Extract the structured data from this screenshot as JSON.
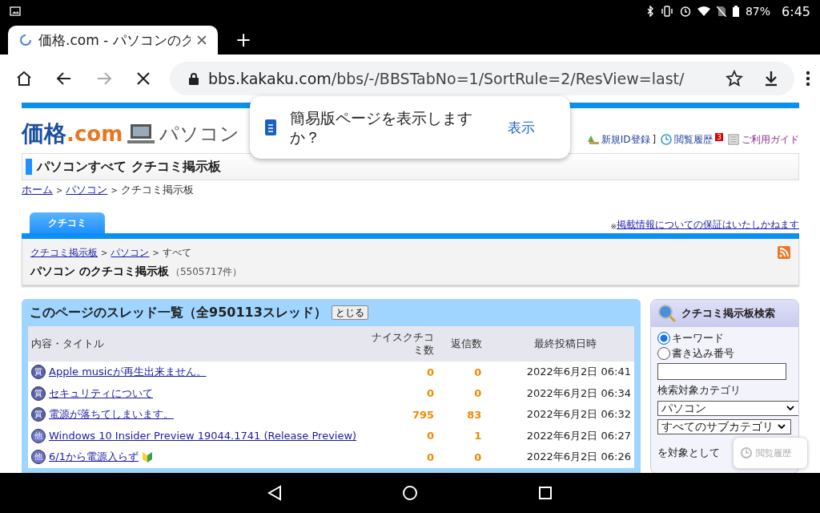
{
  "status_bar": {
    "battery": "87%",
    "time": "6:45"
  },
  "browser": {
    "tab": {
      "title": "価格.com - パソコンのク",
      "loading": true
    },
    "new_tab": "+",
    "address": {
      "host": "bbs.kakaku.com",
      "path": "/bbs/-/BBSTabNo=1/SortRule=2/ResView=last/"
    },
    "forward_disabled": true
  },
  "header": {
    "logo": {
      "main": "価格",
      "suffix": ".com"
    },
    "category": "パソコン",
    "links": [
      {
        "label": "新規ID登録",
        "after": "]"
      },
      {
        "label": "閲覧履歴",
        "badge": "3"
      },
      {
        "label": "ご利用ガイド"
      }
    ]
  },
  "page_title": "パソコンすべて クチコミ掲示板",
  "breadcrumb": [
    {
      "label": "ホーム",
      "link": true,
      "separator": ">"
    },
    {
      "label": "パソコン",
      "link": true,
      "separator": ">"
    },
    {
      "label": "クチコミ掲示板",
      "link": false
    }
  ],
  "tabs": [
    {
      "label": "クチコミ",
      "selected": true
    }
  ],
  "disclaimer": {
    "mark": "※",
    "link": "掲載情報についての保証はいたしかねます"
  },
  "board": {
    "breadcrumb": [
      {
        "label": "クチコミ掲示板",
        "link": true,
        "separator": ">"
      },
      {
        "label": "パソコン",
        "link": true,
        "separator": ">"
      },
      {
        "label": "すべて",
        "link": false
      }
    ],
    "title": "パソコン のクチコミ掲示板",
    "count": "（5505717件）"
  },
  "thread_list": {
    "heading": "このページのスレッド一覧（全950113スレッド）",
    "close_button": "とじる",
    "columns": [
      "内容・タイトル",
      "ナイスクチコミ数",
      "返信数",
      "最終投稿日時"
    ],
    "rows": [
      {
        "kind": "question",
        "icon": "質",
        "title": "Apple musicが再生出来ません。",
        "beginner": false,
        "nice": "0",
        "replies": "0",
        "date": "2022年6月2日 06:41"
      },
      {
        "kind": "question",
        "icon": "質",
        "title": "セキュリティについて",
        "beginner": false,
        "nice": "0",
        "replies": "0",
        "date": "2022年6月2日 06:34"
      },
      {
        "kind": "question",
        "icon": "質",
        "title": "電源が落ちてしまいます。",
        "beginner": false,
        "nice": "795",
        "replies": "83",
        "date": "2022年6月2日 06:32"
      },
      {
        "kind": "other",
        "icon": "他",
        "title": "Windows 10 Insider Preview 19044.1741 (Release Preview)",
        "beginner": false,
        "nice": "0",
        "replies": "1",
        "date": "2022年6月2日 06:27"
      },
      {
        "kind": "other",
        "icon": "他",
        "title": "6/1から電源入らず",
        "beginner": true,
        "nice": "0",
        "replies": "0",
        "date": "2022年6月2日 06:26"
      }
    ]
  },
  "search_panel": {
    "title": "クチコミ掲示板検索",
    "radios": [
      {
        "label": "キーワード",
        "selected": true
      },
      {
        "label": "書き込み番号",
        "selected": false
      }
    ],
    "category_label": "検索対象カテゴリ",
    "selects": [
      "パソコン",
      "すべてのサブカテゴリ"
    ],
    "target_text": "を対象として"
  },
  "lite_prompt": {
    "message": "簡易版ページを表示しますか？",
    "action": "表示"
  },
  "history_button": "閲覧履歴"
}
